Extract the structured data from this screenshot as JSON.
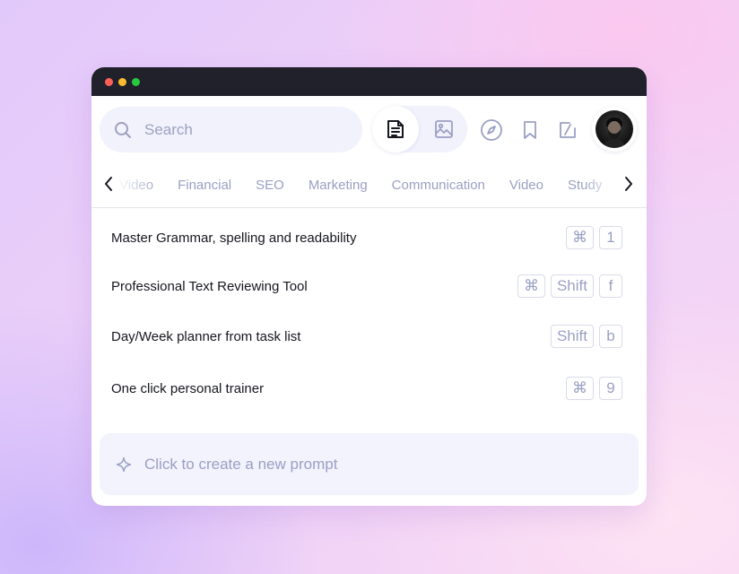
{
  "window": {
    "traffic_lights": [
      "#fe5f57",
      "#febc2e",
      "#28c840"
    ]
  },
  "search": {
    "placeholder": "Search",
    "icon": "search-icon"
  },
  "mode_toggle": {
    "active": "text",
    "items": [
      {
        "icon": "document-icon",
        "selected": true
      },
      {
        "icon": "image-icon",
        "selected": false
      }
    ]
  },
  "toolbar": {
    "icons": [
      "compass-icon",
      "bookmark-icon",
      "edit-icon"
    ],
    "avatar_icon": "user-avatar"
  },
  "tabs": {
    "items": [
      "Video",
      "Financial",
      "SEO",
      "Marketing",
      "Communication",
      "Video",
      "Study"
    ],
    "prev_icon": "chevron-left-icon",
    "next_icon": "chevron-right-icon"
  },
  "prompts": [
    {
      "label": "Master Grammar, spelling and readability",
      "keys": [
        "⌘",
        "1"
      ]
    },
    {
      "label": "Professional Text Reviewing Tool",
      "keys": [
        "⌘",
        "Shift",
        "f"
      ]
    },
    {
      "label": "Day/Week planner from task list",
      "keys": [
        "Shift",
        "b"
      ]
    },
    {
      "label": "One click personal trainer",
      "keys": [
        "⌘",
        "9"
      ]
    }
  ],
  "new_prompt": {
    "label": "Click to create a new prompt",
    "icon": "sparkle-icon"
  },
  "colors": {
    "accent_bg": "#f1f2fc",
    "muted_text": "#9ba0c3",
    "titlebar": "#20212b"
  }
}
